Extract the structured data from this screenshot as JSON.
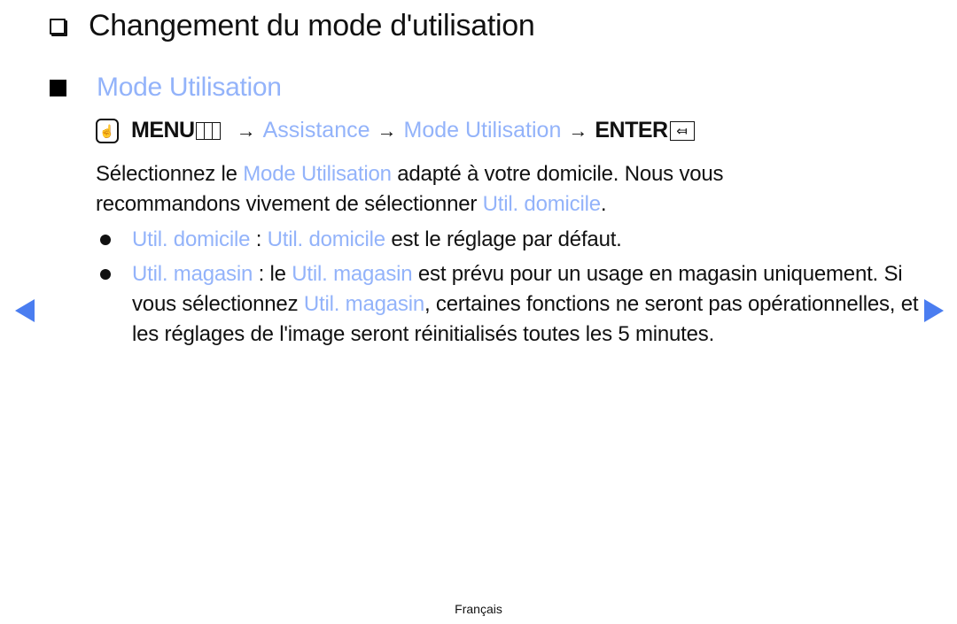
{
  "page": {
    "title": "Changement du mode d'utilisation",
    "section_title": "Mode Utilisation"
  },
  "menu_path": {
    "hand_icon": "remote-menu-hand-icon",
    "menu": "MENU",
    "arrow": "→",
    "step1": "Assistance",
    "step2": "Mode Utilisation",
    "enter": "ENTER",
    "enter_glyph": "⤆"
  },
  "intro": {
    "t1": "Sélectionnez le ",
    "h1": "Mode Utilisation",
    "t2": " adapté à votre domicile. Nous vous recommandons vivement de sélectionner ",
    "h2": "Util. domicile",
    "t3": "."
  },
  "bullets": [
    {
      "h1": "Util. domicile",
      "t1": " : ",
      "h2": "Util. domicile",
      "t2": " est le réglage par défaut."
    },
    {
      "h1": "Util. magasin",
      "t1": " : le ",
      "h2": "Util. magasin",
      "t2": " est prévu pour un usage en magasin uniquement. Si vous sélectionnez ",
      "h3": "Util. magasin",
      "t3": ", certaines fonctions ne seront pas opérationnelles, et les réglages de l'image seront réinitialisés toutes les 5 minutes."
    }
  ],
  "nav": {
    "prev": "previous-page",
    "next": "next-page"
  },
  "footer": {
    "language": "Français"
  },
  "colors": {
    "highlight": "#93b3fa",
    "nav_arrow": "#4a7df0",
    "text": "#111111"
  }
}
